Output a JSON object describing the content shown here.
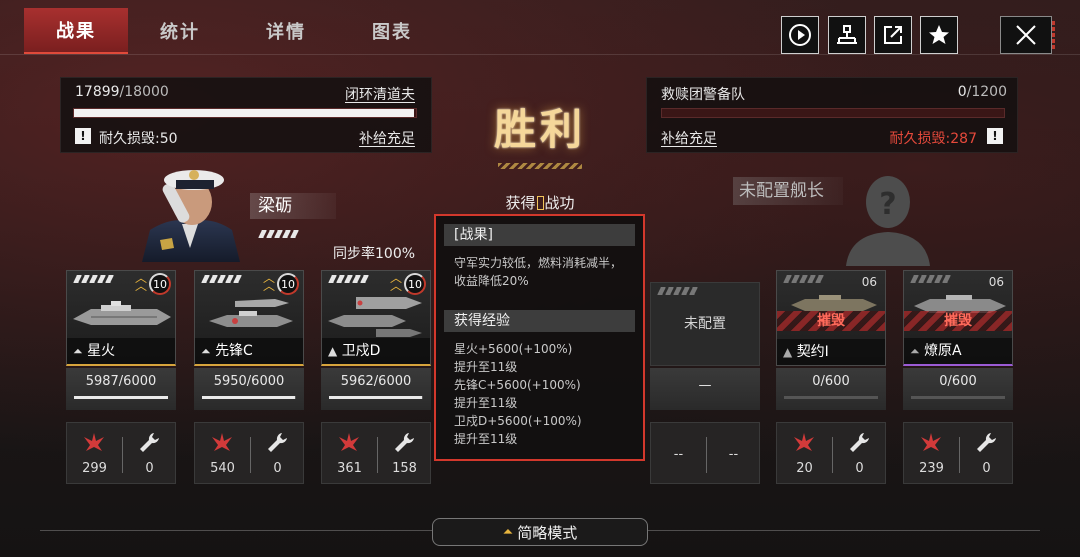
{
  "tabs": [
    {
      "label": "战果",
      "active": true
    },
    {
      "label": "统计",
      "active": false
    },
    {
      "label": "详情",
      "active": false
    },
    {
      "label": "图表",
      "active": false
    }
  ],
  "toolbar_icons": [
    "play-icon",
    "share-node-icon",
    "external-link-icon",
    "star-icon",
    "close-icon"
  ],
  "left_fleet": {
    "hp_current": "17899",
    "hp_max": "/18000",
    "hp_fraction": 0.994,
    "fleet_name": "闭环清道夫",
    "durability_loss": "耐久损毁:50",
    "supply": "补给充足"
  },
  "right_fleet": {
    "fleet_name": "救赎团警备队",
    "hp_current": "0",
    "hp_max": "/1200",
    "hp_fraction": 0.0,
    "supply": "补给充足",
    "durability_loss": "耐久损毁:287"
  },
  "result": {
    "title": "胜利",
    "merit_prefix": "获得",
    "merit_suffix": "战功"
  },
  "report": {
    "section1_title": "[战果]",
    "section1_text": "守军实力较低，燃料消耗减半，收益降低20%",
    "section2_title": "获得经验",
    "exp_lines": [
      "星火+5600(+100%)",
      "提升至11级",
      "先锋C+5600(+100%)",
      "提升至11级",
      "卫戍D+5600(+100%)",
      "提升至11级"
    ]
  },
  "commander": {
    "name": "梁砺",
    "sync_rate": "同步率100%"
  },
  "enemy_commander": {
    "label": "未配置舰长"
  },
  "left_ships": [
    {
      "name": "星火",
      "level": "10",
      "hp": "5987/6000",
      "hp_fraction": 0.998,
      "damage": "299",
      "repair": "0"
    },
    {
      "name": "先锋C",
      "level": "10",
      "hp": "5950/6000",
      "hp_fraction": 0.992,
      "damage": "540",
      "repair": "0"
    },
    {
      "name": "卫戍D",
      "level": "10",
      "hp": "5962/6000",
      "hp_fraction": 0.994,
      "damage": "361",
      "repair": "158"
    }
  ],
  "right_ships": [
    {
      "name": "未配置",
      "level": "",
      "hp": "—",
      "hp_fraction": 0,
      "damage": "--",
      "repair": "--",
      "status": ""
    },
    {
      "name": "契约I",
      "level": "06",
      "hp": "0/600",
      "hp_fraction": 0,
      "damage": "20",
      "repair": "0",
      "status": "摧毁"
    },
    {
      "name": "燎原A",
      "level": "06",
      "hp": "0/600",
      "hp_fraction": 0,
      "damage": "239",
      "repair": "0",
      "status": "摧毁"
    }
  ],
  "bottom": {
    "mode_button": "简略模式"
  },
  "colors": {
    "accent_red": "#d3382c",
    "victory_gold": "#f5d79a",
    "rank_gold": "#e8b53e"
  }
}
